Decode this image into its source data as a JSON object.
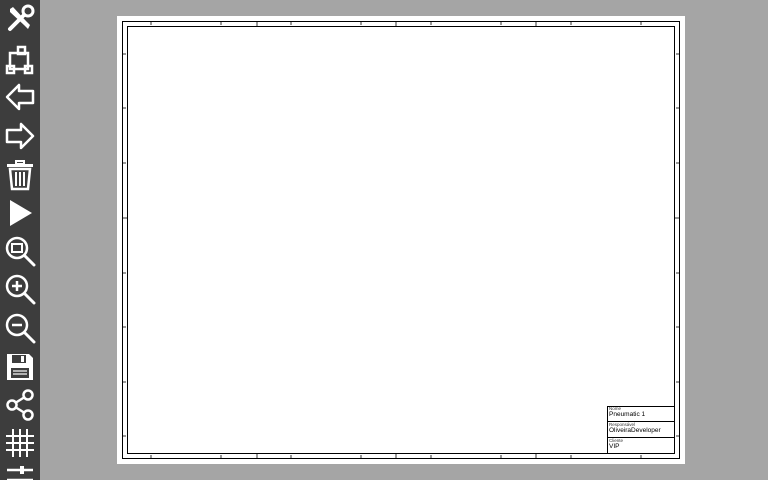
{
  "toolbar": {
    "tools": [
      {
        "name": "settings",
        "icon": "tools-icon"
      },
      {
        "name": "components",
        "icon": "component-icon"
      },
      {
        "name": "undo",
        "icon": "arrow-left-icon"
      },
      {
        "name": "redo",
        "icon": "arrow-right-icon"
      },
      {
        "name": "delete",
        "icon": "trash-icon"
      },
      {
        "name": "simulate",
        "icon": "play-icon"
      },
      {
        "name": "zoom-fit",
        "icon": "zoom-fit-icon"
      },
      {
        "name": "zoom-in",
        "icon": "zoom-in-icon"
      },
      {
        "name": "zoom-out",
        "icon": "zoom-out-icon"
      },
      {
        "name": "save",
        "icon": "save-icon"
      },
      {
        "name": "share",
        "icon": "share-icon"
      },
      {
        "name": "grid",
        "icon": "grid-icon"
      },
      {
        "name": "more",
        "icon": "sliders-icon"
      }
    ]
  },
  "colors": {
    "toolbar_bg": "#3d3d3d",
    "icon_color": "#ffffff",
    "canvas_bg": "#a5a5a5",
    "sheet_bg": "#ffffff",
    "frame_color": "#000000"
  },
  "title_block": {
    "name_label": "Nome",
    "name_value": "Pneumatic 1",
    "responsible_label": "Responsável",
    "responsible_value": "OliveiraDeveloper",
    "client_label": "Cliente",
    "client_value": "VIP"
  }
}
